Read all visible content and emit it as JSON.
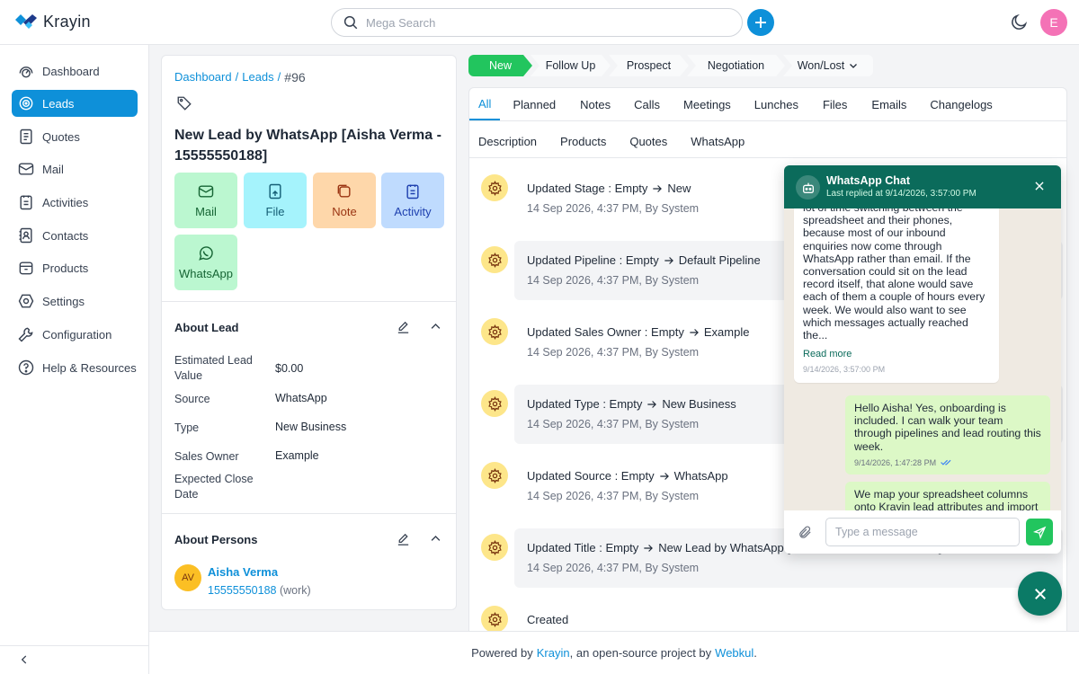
{
  "app": {
    "name": "Krayin",
    "avatar_initial": "E"
  },
  "search": {
    "placeholder": "Mega Search"
  },
  "sidebar": {
    "items": [
      {
        "label": "Dashboard",
        "icon": "dashboard-icon"
      },
      {
        "label": "Leads",
        "icon": "leads-icon",
        "active": true
      },
      {
        "label": "Quotes",
        "icon": "quotes-icon"
      },
      {
        "label": "Mail",
        "icon": "mail-icon"
      },
      {
        "label": "Activities",
        "icon": "activities-icon"
      },
      {
        "label": "Contacts",
        "icon": "contacts-icon"
      },
      {
        "label": "Products",
        "icon": "products-icon"
      },
      {
        "label": "Settings",
        "icon": "settings-icon"
      },
      {
        "label": "Configuration",
        "icon": "configuration-icon"
      },
      {
        "label": "Help & Resources",
        "icon": "help-icon"
      }
    ]
  },
  "breadcrumb": {
    "dashboard": "Dashboard",
    "leads": "Leads",
    "sep": "/",
    "current": "#96"
  },
  "lead": {
    "title": "New Lead by WhatsApp [Aisha Verma - 15555550188]"
  },
  "actions": {
    "mail": "Mail",
    "file": "File",
    "note": "Note",
    "activity": "Activity",
    "whatsapp": "WhatsApp"
  },
  "about_lead": {
    "title": "About Lead",
    "fields": [
      {
        "label": "Estimated Lead Value",
        "value": "$0.00"
      },
      {
        "label": "Source",
        "value": "WhatsApp"
      },
      {
        "label": "Type",
        "value": "New Business"
      },
      {
        "label": "Sales Owner",
        "value": "Example"
      },
      {
        "label": "Expected Close Date",
        "value": ""
      }
    ]
  },
  "about_persons": {
    "title": "About Persons",
    "initials": "AV",
    "name": "Aisha Verma",
    "phone": "15555550188",
    "phone_type": "(work)"
  },
  "stages": [
    "New",
    "Follow Up",
    "Prospect",
    "Negotiation",
    "Won/Lost"
  ],
  "tabs": {
    "row1": [
      "All",
      "Planned",
      "Notes",
      "Calls",
      "Meetings",
      "Lunches",
      "Files",
      "Emails",
      "Changelogs"
    ],
    "row2": [
      "Description",
      "Products",
      "Quotes",
      "WhatsApp"
    ]
  },
  "activities": [
    {
      "title": "Updated Stage : Empty",
      "to": "New",
      "meta": "14 Sep 2026, 4:37 PM, By System"
    },
    {
      "title": "Updated Pipeline : Empty",
      "to": "Default Pipeline",
      "meta": "14 Sep 2026, 4:37 PM, By System"
    },
    {
      "title": "Updated Sales Owner : Empty",
      "to": "Example",
      "meta": "14 Sep 2026, 4:37 PM, By System"
    },
    {
      "title": "Updated Type : Empty",
      "to": "New Business",
      "meta": "14 Sep 2026, 4:37 PM, By System"
    },
    {
      "title": "Updated Source : Empty",
      "to": "WhatsApp",
      "meta": "14 Sep 2026, 4:37 PM, By System"
    },
    {
      "title": "Updated Title : Empty",
      "to": "New Lead by WhatsApp [Aisha Verma - 15555550188]",
      "meta": "14 Sep 2026, 4:37 PM, By System"
    },
    {
      "title": "Created",
      "to": "",
      "meta": ""
    }
  ],
  "chat": {
    "title": "WhatsApp Chat",
    "subtitle": "Last replied at 9/14/2026, 3:57:00 PM",
    "incoming": {
      "text": "lot of time switching between the spreadsheet and their phones, because most of our inbound enquiries now come through WhatsApp rather than email. If the conversation could sit on the lead record itself, that alone would save each of them a couple of hours every week. We would also want to see which messages actually reached the...",
      "read_more": "Read more",
      "time": "9/14/2026, 3:57:00 PM"
    },
    "outgoing": [
      {
        "text": "Hello Aisha! Yes, onboarding is included. I can walk your team through pipelines and lead routing this week.",
        "time": "9/14/2026, 1:47:28 PM"
      },
      {
        "text": "We map your spreadsheet columns onto Krayin lead attributes and import",
        "time": ""
      }
    ],
    "input_placeholder": "Type a message"
  },
  "footer": {
    "prefix": "Powered by",
    "krayin": "Krayin",
    "middle": ", an open-source project by",
    "webkul": "Webkul",
    "suffix": "."
  },
  "colors": {
    "primary": "#0e90d9",
    "whatsapp_header": "#0b6b5b",
    "stage_active": "#22c55e"
  }
}
